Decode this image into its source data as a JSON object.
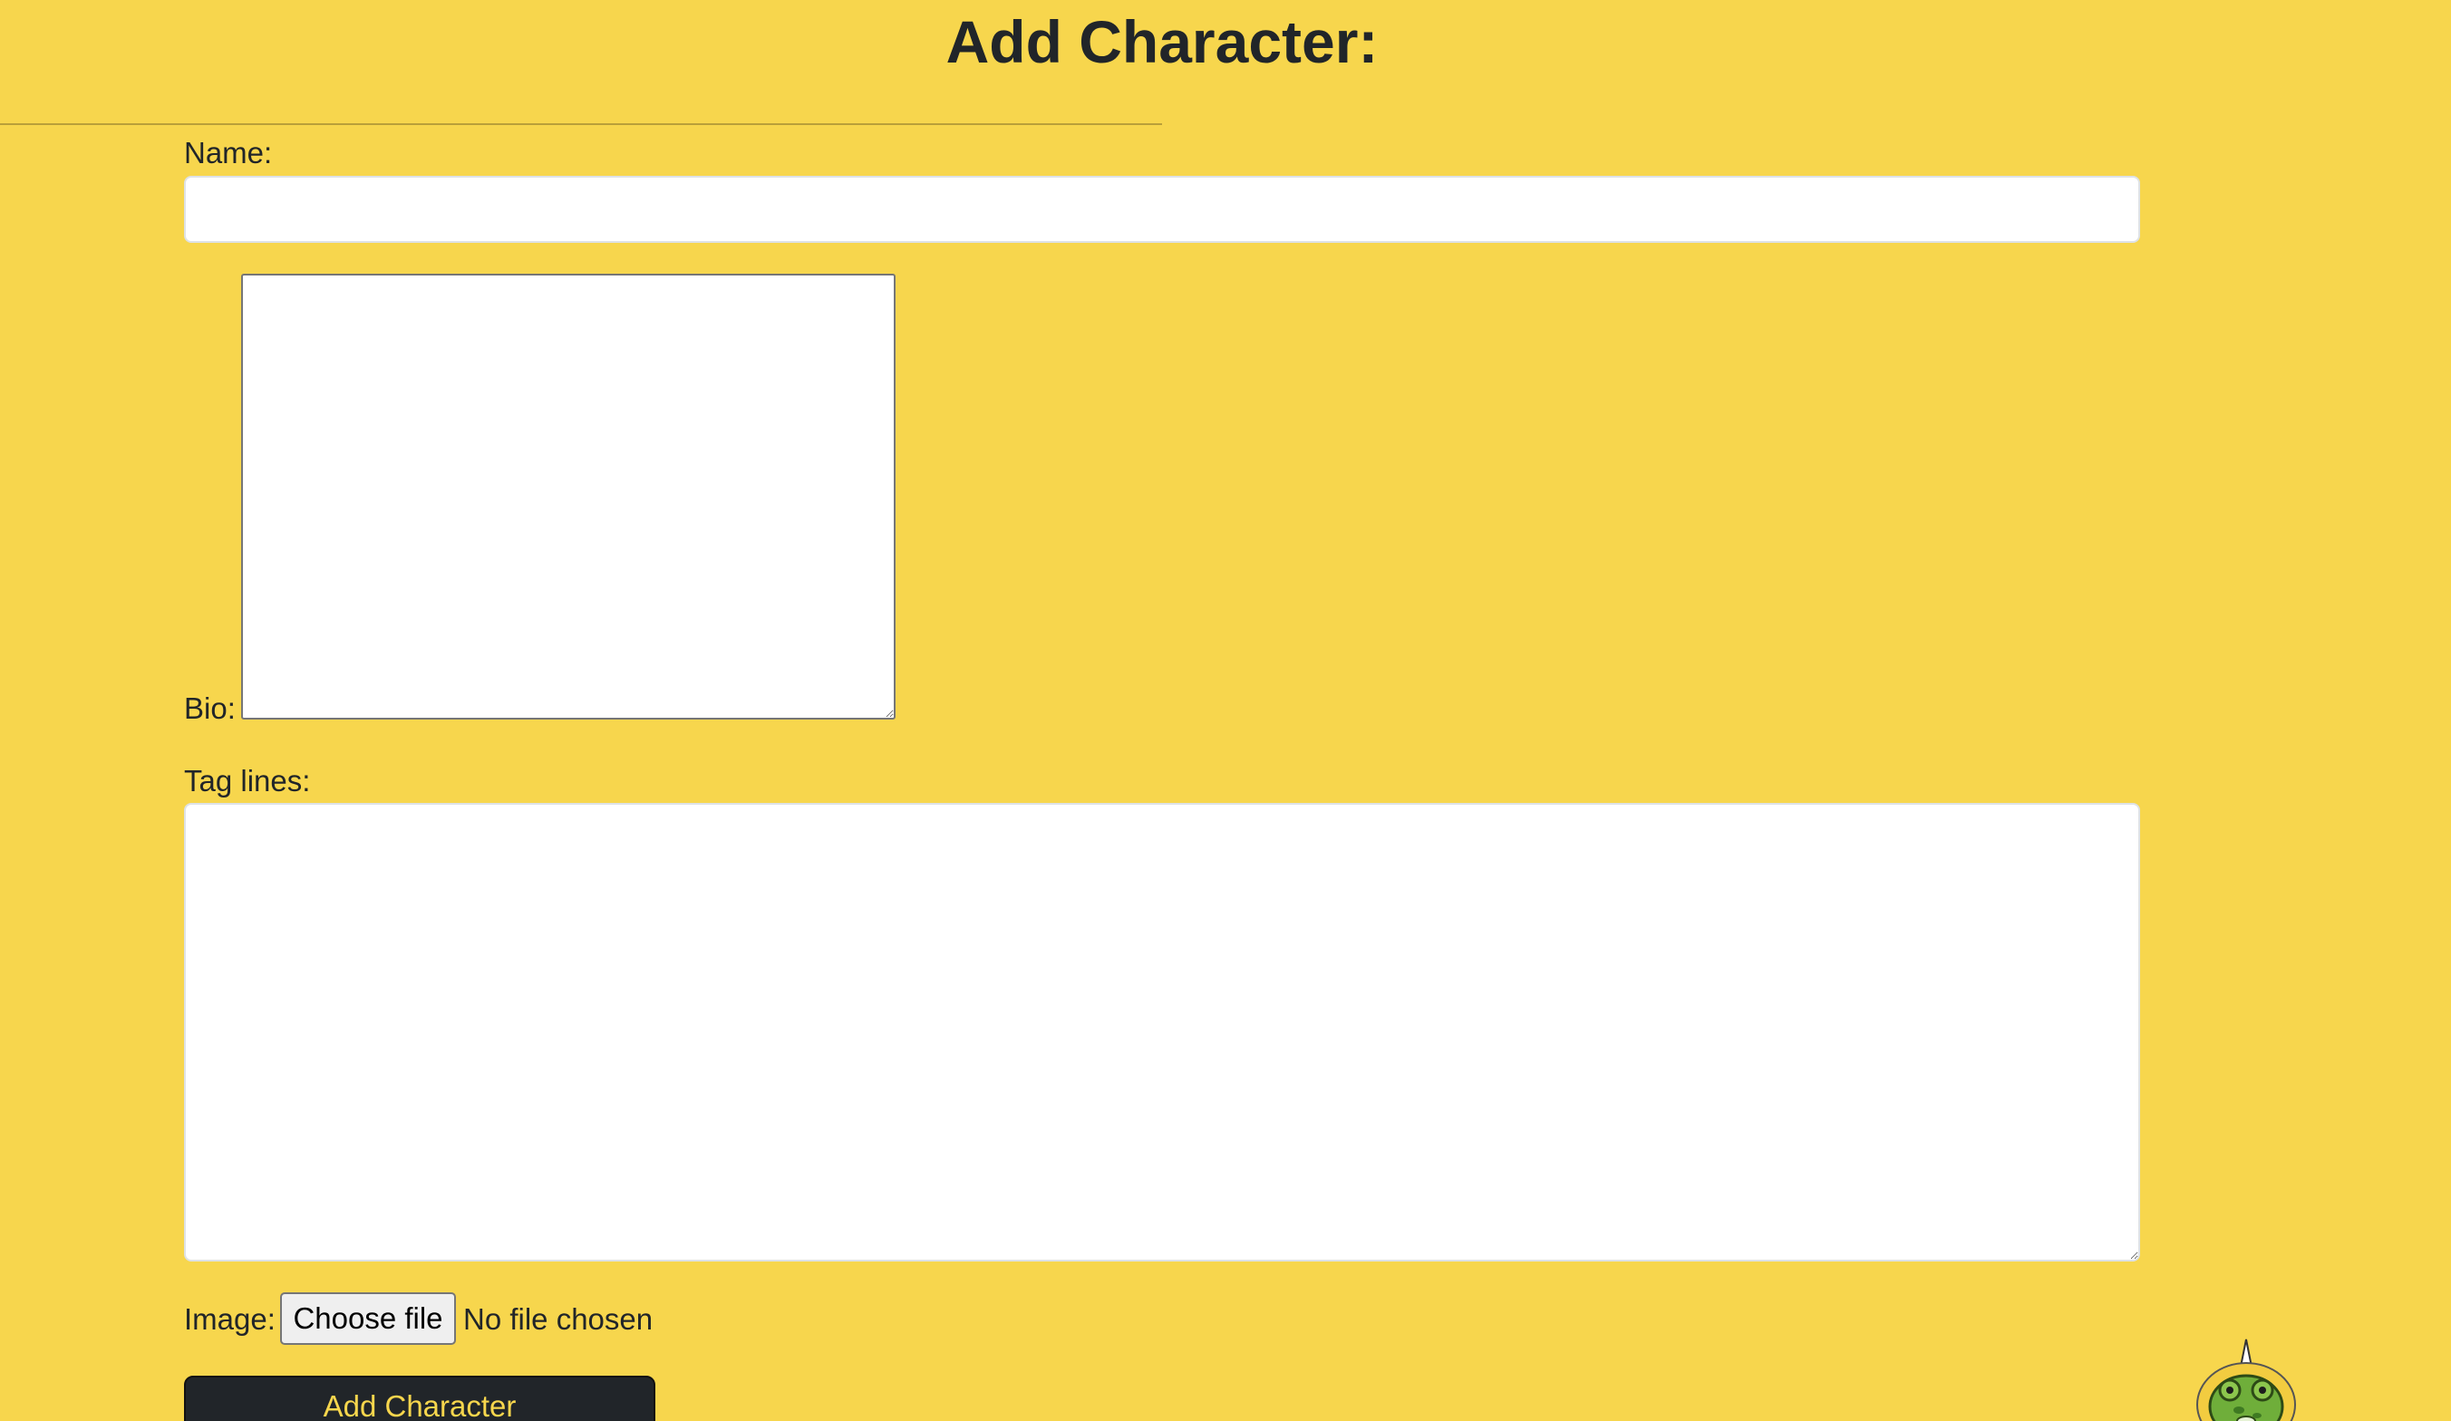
{
  "page": {
    "title": "Add Character:"
  },
  "form": {
    "name": {
      "label": "Name:",
      "value": "",
      "placeholder": ""
    },
    "bio": {
      "label": "Bio:",
      "value": ""
    },
    "tag_lines": {
      "label": "Tag lines:",
      "value": ""
    },
    "image": {
      "label": "Image:",
      "button_label": "Choose file",
      "status_text": "No file chosen"
    },
    "submit_label": "Add Character"
  },
  "mascot": {
    "icon": "frog-mascot-icon"
  },
  "colors": {
    "background": "#f7d64d",
    "button_bg": "#212529",
    "button_text": "#f7d64d",
    "text": "#212529"
  }
}
